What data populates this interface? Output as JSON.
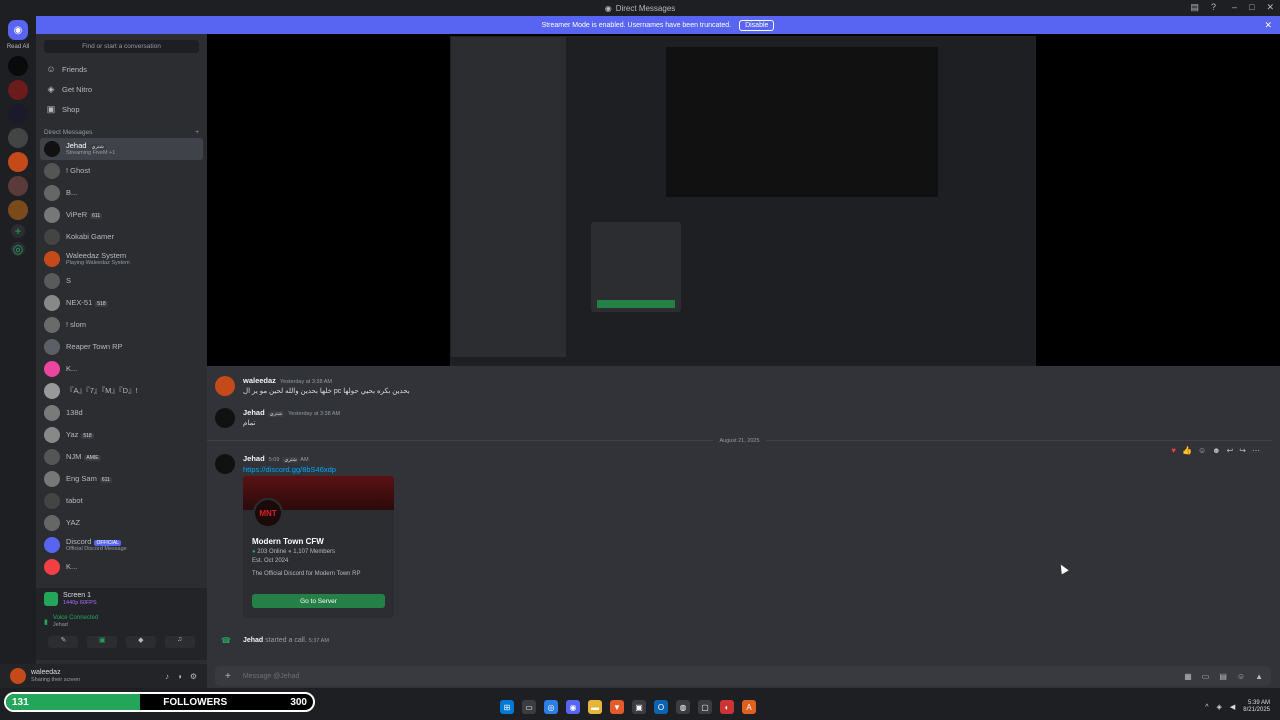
{
  "window": {
    "title": "Direct Messages"
  },
  "banner": {
    "text": "Streamer Mode is enabled. Usernames have been truncated.",
    "disable_label": "Disable"
  },
  "servers": {
    "read_all": "Read All"
  },
  "sidebar": {
    "search_placeholder": "Find or start a conversation",
    "nav": [
      {
        "label": "Friends"
      },
      {
        "label": "Get Nitro"
      },
      {
        "label": "Shop"
      }
    ],
    "dm_header": "Direct Messages",
    "dms": [
      {
        "name": "Jehad",
        "tag": "شتري",
        "sub": "Streaming FiveM +1"
      },
      {
        "name": "! Ghost",
        "tag": "",
        "sub": ""
      },
      {
        "name": "B...",
        "tag": "",
        "sub": ""
      },
      {
        "name": "ViPeR",
        "tag": "611",
        "sub": ""
      },
      {
        "name": "Kokabi Gamer",
        "tag": "",
        "sub": ""
      },
      {
        "name": "Waleedaz System",
        "tag": "",
        "sub": "Playing Waleedaz System"
      },
      {
        "name": "S",
        "tag": "",
        "sub": ""
      },
      {
        "name": "NEX-51",
        "tag": "518",
        "sub": ""
      },
      {
        "name": "! slom",
        "tag": "",
        "sub": ""
      },
      {
        "name": "Reaper Town RP",
        "tag": "",
        "sub": ""
      },
      {
        "name": "K...",
        "tag": "",
        "sub": ""
      },
      {
        "name": "『A』『7』『M』『D』!",
        "tag": "",
        "sub": ""
      },
      {
        "name": "138d",
        "tag": "",
        "sub": ""
      },
      {
        "name": "Yaz",
        "tag": "518",
        "sub": ""
      },
      {
        "name": "NJM",
        "tag": "AMIE",
        "sub": ""
      },
      {
        "name": "Eng Sam",
        "tag": "611",
        "sub": ""
      },
      {
        "name": "tabot",
        "tag": "",
        "sub": ""
      },
      {
        "name": "YAZ",
        "tag": "",
        "sub": ""
      },
      {
        "name": "Discord",
        "tag": "OFFICIAL",
        "sub": "Official Discord Message"
      },
      {
        "name": "K...",
        "tag": "",
        "sub": ""
      }
    ]
  },
  "voice": {
    "screen_title": "Screen 1",
    "screen_sub": "1440p 60FPS",
    "status": "Voice Connected",
    "channel": "Jehad"
  },
  "user": {
    "name": "waleedaz",
    "status": "Sharing their screen"
  },
  "followers": {
    "count": "131",
    "label": "FOLLOWERS",
    "goal": "300",
    "progress": 0.437
  },
  "messages": [
    {
      "author": "waleedaz",
      "time": "Yesterday at 3:38 AM",
      "text": "خلها بحدين والله لحين مو ير ال pc بحدين بكره بحيي حولها"
    },
    {
      "author": "Jehad",
      "tag": "شتري",
      "time": "Yesterday at 3:38 AM",
      "text": "تمام"
    },
    {
      "author": "Jehad",
      "tag": "شتري",
      "time": "5:09 AM",
      "link": "https://discord.gg/8bS46xdp"
    }
  ],
  "date_divider": "August 21, 2025",
  "invite": {
    "logo": "MNT",
    "server_name": "Modern Town CFW",
    "online": "203 Online",
    "members": "1,107 Members",
    "est": "Est. Oct 2024",
    "desc": "The Official Discord for Modern Town RP",
    "button": "Go to Server"
  },
  "call": {
    "author": "Jehad",
    "text": "started a call.",
    "time": "5:37 AM"
  },
  "composer": {
    "placeholder": "Message @Jehad"
  },
  "taskbar": {
    "time": "5:39 AM",
    "date": "8/21/2025"
  }
}
